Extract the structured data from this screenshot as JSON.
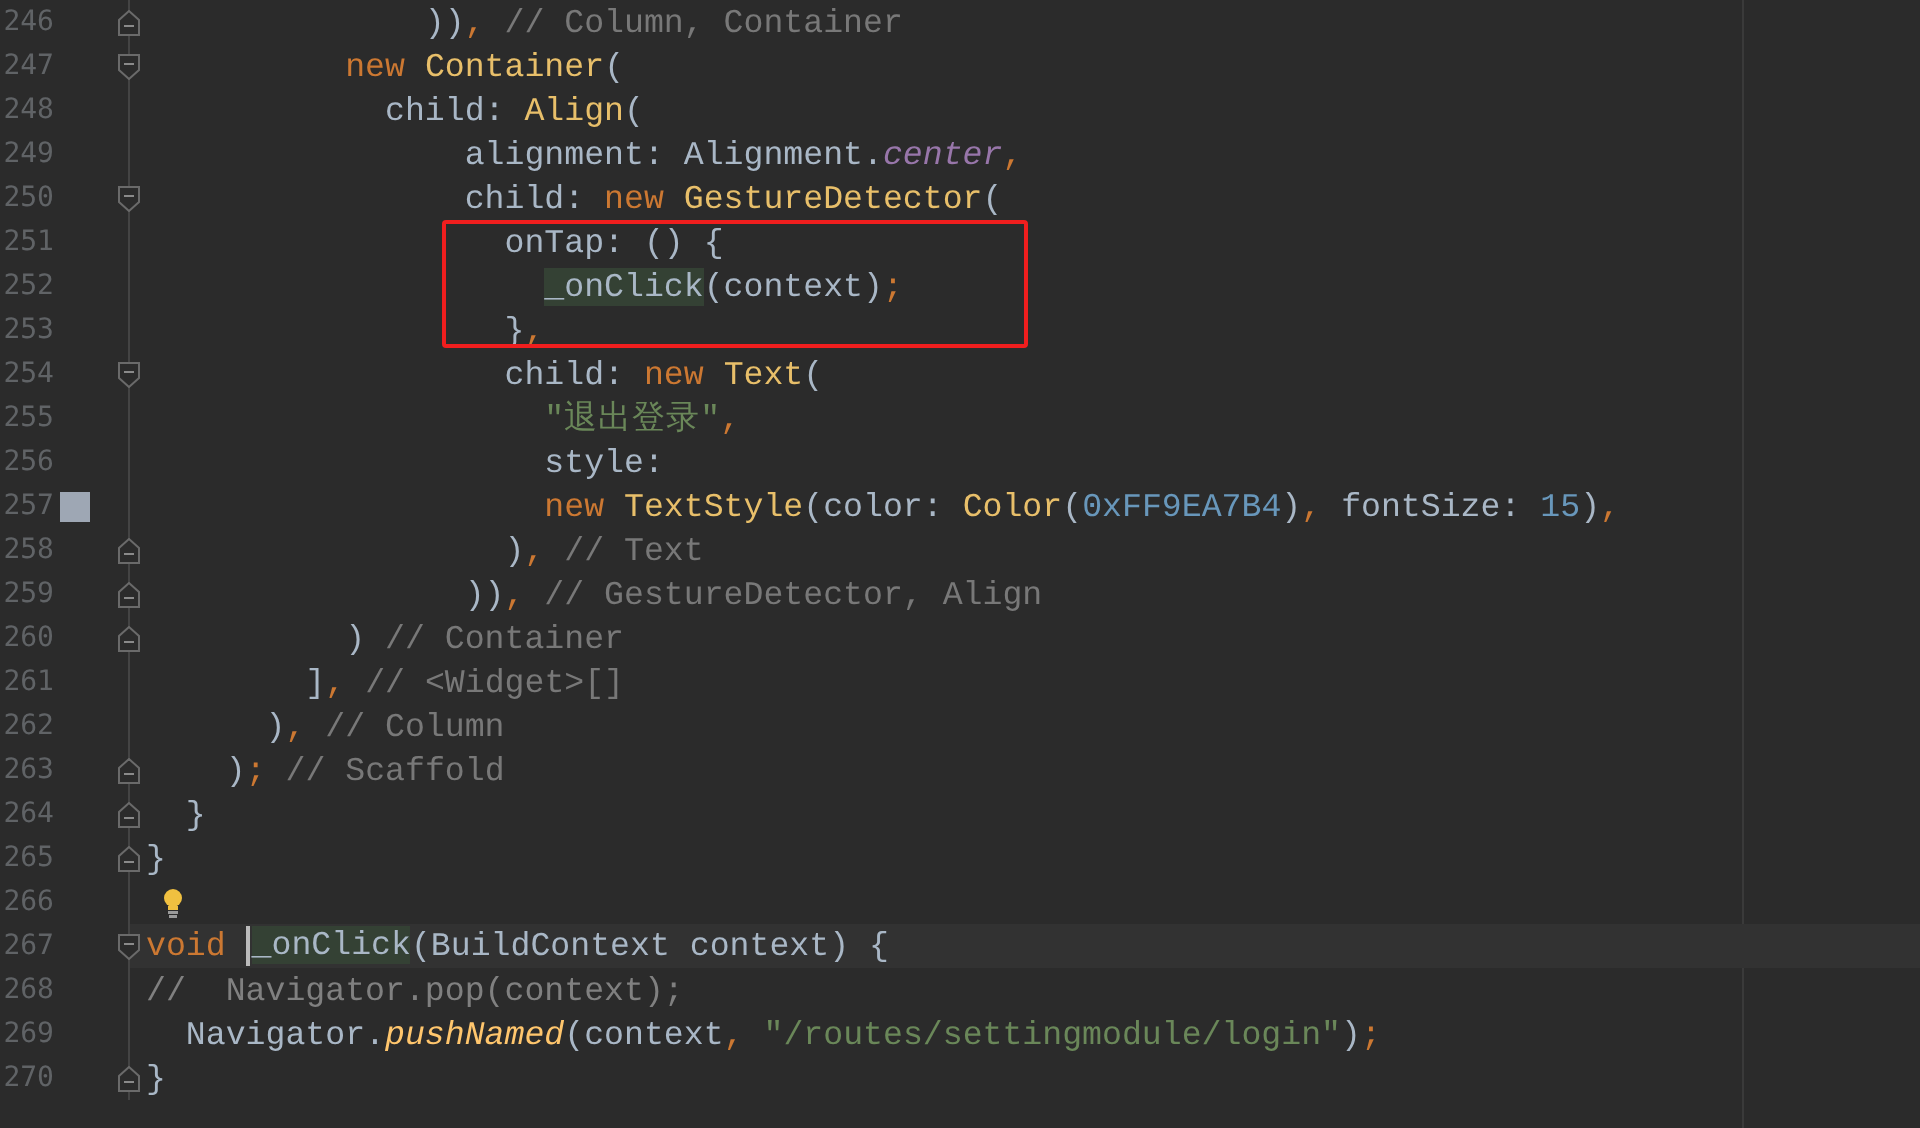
{
  "editor": {
    "segments": [
      {
        "boxed": false,
        "lines": [
          {
            "number": "246",
            "fold": {
              "kind": "end"
            },
            "tokens": [
              {
                "kind": "plain",
                "text": "              ))"
              },
              {
                "kind": "punct",
                "text": ","
              },
              {
                "kind": "hint",
                "text": " // Column, Container"
              }
            ]
          },
          {
            "number": "247",
            "fold": {
              "kind": "start"
            },
            "tokens": [
              {
                "kind": "keyword",
                "text": "          new "
              },
              {
                "kind": "class",
                "text": "Container"
              },
              {
                "kind": "plain",
                "text": "("
              }
            ]
          },
          {
            "number": "248",
            "tokens": [
              {
                "kind": "plain",
                "text": "            child: "
              },
              {
                "kind": "class",
                "text": "Align"
              },
              {
                "kind": "plain",
                "text": "("
              }
            ]
          },
          {
            "number": "249",
            "tokens": [
              {
                "kind": "plain",
                "text": "                alignment: Alignment."
              },
              {
                "kind": "field",
                "text": "center"
              },
              {
                "kind": "punct",
                "text": ","
              }
            ]
          },
          {
            "number": "250",
            "fold": {
              "kind": "start"
            },
            "tokens": [
              {
                "kind": "plain",
                "text": "                child: "
              },
              {
                "kind": "keyword",
                "text": "new "
              },
              {
                "kind": "class",
                "text": "GestureDetector"
              },
              {
                "kind": "plain",
                "text": "("
              }
            ]
          }
        ]
      },
      {
        "boxed": true,
        "lines": [
          {
            "number": "251",
            "tokens": [
              {
                "kind": "plain",
                "text": "                  onTap: () {"
              }
            ]
          },
          {
            "number": "252",
            "tokens": [
              {
                "kind": "usage",
                "text": "                    _onClick"
              },
              {
                "kind": "plain",
                "text": "(context)"
              },
              {
                "kind": "punct",
                "text": ";"
              }
            ]
          },
          {
            "number": "253",
            "tokens": [
              {
                "kind": "plain",
                "text": "                  }"
              },
              {
                "kind": "punct",
                "text": ","
              }
            ]
          }
        ]
      },
      {
        "boxed": false,
        "lines": [
          {
            "number": "254",
            "fold": {
              "kind": "start"
            },
            "tokens": [
              {
                "kind": "plain",
                "text": "                  child: "
              },
              {
                "kind": "keyword",
                "text": "new "
              },
              {
                "kind": "class",
                "text": "Text"
              },
              {
                "kind": "plain",
                "text": "("
              }
            ]
          },
          {
            "number": "255",
            "tokens": [
              {
                "kind": "string",
                "text": "                    \"退出登录\""
              },
              {
                "kind": "punct",
                "text": ","
              }
            ]
          },
          {
            "number": "256",
            "tokens": [
              {
                "kind": "plain",
                "text": "                    style:"
              }
            ]
          },
          {
            "number": "257",
            "swatch": {
              "color": "#9ea7b4"
            },
            "tokens": [
              {
                "kind": "keyword",
                "text": "                    new "
              },
              {
                "kind": "class",
                "text": "TextStyle"
              },
              {
                "kind": "plain",
                "text": "(color: "
              },
              {
                "kind": "class",
                "text": "Color"
              },
              {
                "kind": "plain",
                "text": "("
              },
              {
                "kind": "number",
                "text": "0xFF9EA7B4"
              },
              {
                "kind": "plain",
                "text": ")"
              },
              {
                "kind": "punct",
                "text": ", "
              },
              {
                "kind": "plain",
                "text": "fontSize: "
              },
              {
                "kind": "number",
                "text": "15"
              },
              {
                "kind": "plain",
                "text": ")"
              },
              {
                "kind": "punct",
                "text": ","
              }
            ]
          },
          {
            "number": "258",
            "fold": {
              "kind": "end"
            },
            "tokens": [
              {
                "kind": "plain",
                "text": "                  )"
              },
              {
                "kind": "punct",
                "text": ","
              },
              {
                "kind": "hint",
                "text": " // Text"
              }
            ]
          },
          {
            "number": "259",
            "fold": {
              "kind": "end"
            },
            "tokens": [
              {
                "kind": "plain",
                "text": "                ))"
              },
              {
                "kind": "punct",
                "text": ","
              },
              {
                "kind": "hint",
                "text": " // GestureDetector, Align"
              }
            ]
          },
          {
            "number": "260",
            "fold": {
              "kind": "end"
            },
            "tokens": [
              {
                "kind": "plain",
                "text": "          )"
              },
              {
                "kind": "hint",
                "text": " // Container"
              }
            ]
          },
          {
            "number": "261",
            "tokens": [
              {
                "kind": "plain",
                "text": "        ]"
              },
              {
                "kind": "punct",
                "text": ","
              },
              {
                "kind": "hint",
                "text": " // <Widget>[]"
              }
            ]
          },
          {
            "number": "262",
            "tokens": [
              {
                "kind": "plain",
                "text": "      )"
              },
              {
                "kind": "punct",
                "text": ","
              },
              {
                "kind": "hint",
                "text": " // Column"
              }
            ]
          },
          {
            "number": "263",
            "fold": {
              "kind": "end"
            },
            "tokens": [
              {
                "kind": "plain",
                "text": "    )"
              },
              {
                "kind": "punct",
                "text": ";"
              },
              {
                "kind": "hint",
                "text": " // Scaffold"
              }
            ]
          },
          {
            "number": "264",
            "fold": {
              "kind": "end"
            },
            "tokens": [
              {
                "kind": "plain",
                "text": "  }"
              }
            ]
          },
          {
            "number": "265",
            "fold": {
              "kind": "end"
            },
            "tokens": [
              {
                "kind": "plain",
                "text": "}"
              }
            ]
          },
          {
            "number": "266",
            "bulb": true
          },
          {
            "number": "267",
            "fold": {
              "kind": "start"
            },
            "current": true,
            "tokens": [
              {
                "kind": "keyword",
                "text": "void "
              },
              {
                "kind": "caret"
              },
              {
                "kind": "usage",
                "text": "_onClick"
              },
              {
                "kind": "plain",
                "text": "(BuildContext context) {"
              }
            ]
          },
          {
            "number": "268",
            "tokens": [
              {
                "kind": "comment",
                "text": "//  Navigator.pop(context);"
              }
            ]
          },
          {
            "number": "269",
            "tokens": [
              {
                "kind": "plain",
                "text": "  Navigator."
              },
              {
                "kind": "method",
                "text": "pushNamed"
              },
              {
                "kind": "plain",
                "text": "(context"
              },
              {
                "kind": "punct",
                "text": ", "
              },
              {
                "kind": "string",
                "text": "\"/routes/settingmodule/login\""
              },
              {
                "kind": "plain",
                "text": ")"
              },
              {
                "kind": "punct",
                "text": ";"
              }
            ]
          },
          {
            "number": "270",
            "fold": {
              "kind": "end"
            },
            "tokens": [
              {
                "kind": "plain",
                "text": "}"
              }
            ]
          }
        ]
      }
    ]
  }
}
